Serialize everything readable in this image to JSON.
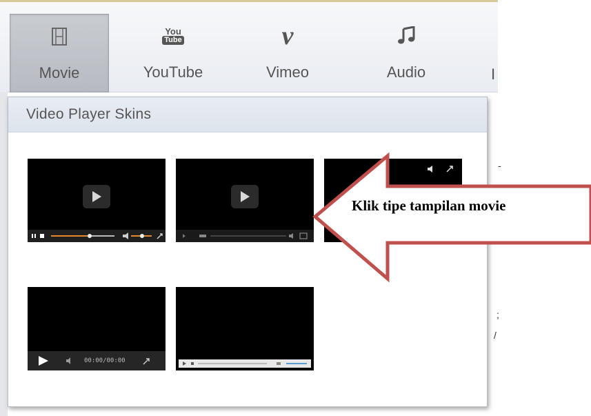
{
  "toolbar": {
    "tabs": [
      {
        "label": "Movie",
        "icon": "film-icon",
        "active": true
      },
      {
        "label": "YouTube",
        "icon": "youtube-icon",
        "active": false
      },
      {
        "label": "Vimeo",
        "icon": "vimeo-icon",
        "active": false
      },
      {
        "label": "Audio",
        "icon": "music-note-icon",
        "active": false
      }
    ],
    "youtube_logo_top": "You",
    "youtube_logo_bottom": "Tube",
    "vimeo_logo": "v"
  },
  "panel": {
    "title": "Video Player Skins",
    "skins": [
      {
        "name": "skin-1",
        "time": ""
      },
      {
        "name": "skin-2",
        "time": ""
      },
      {
        "name": "skin-3",
        "time": ""
      },
      {
        "name": "skin-4",
        "time": "00:00/00:00"
      },
      {
        "name": "skin-5",
        "time": ""
      }
    ]
  },
  "annotation": {
    "text": "Klik tipe tampilan movie",
    "arrow_color": "#c0504d"
  }
}
